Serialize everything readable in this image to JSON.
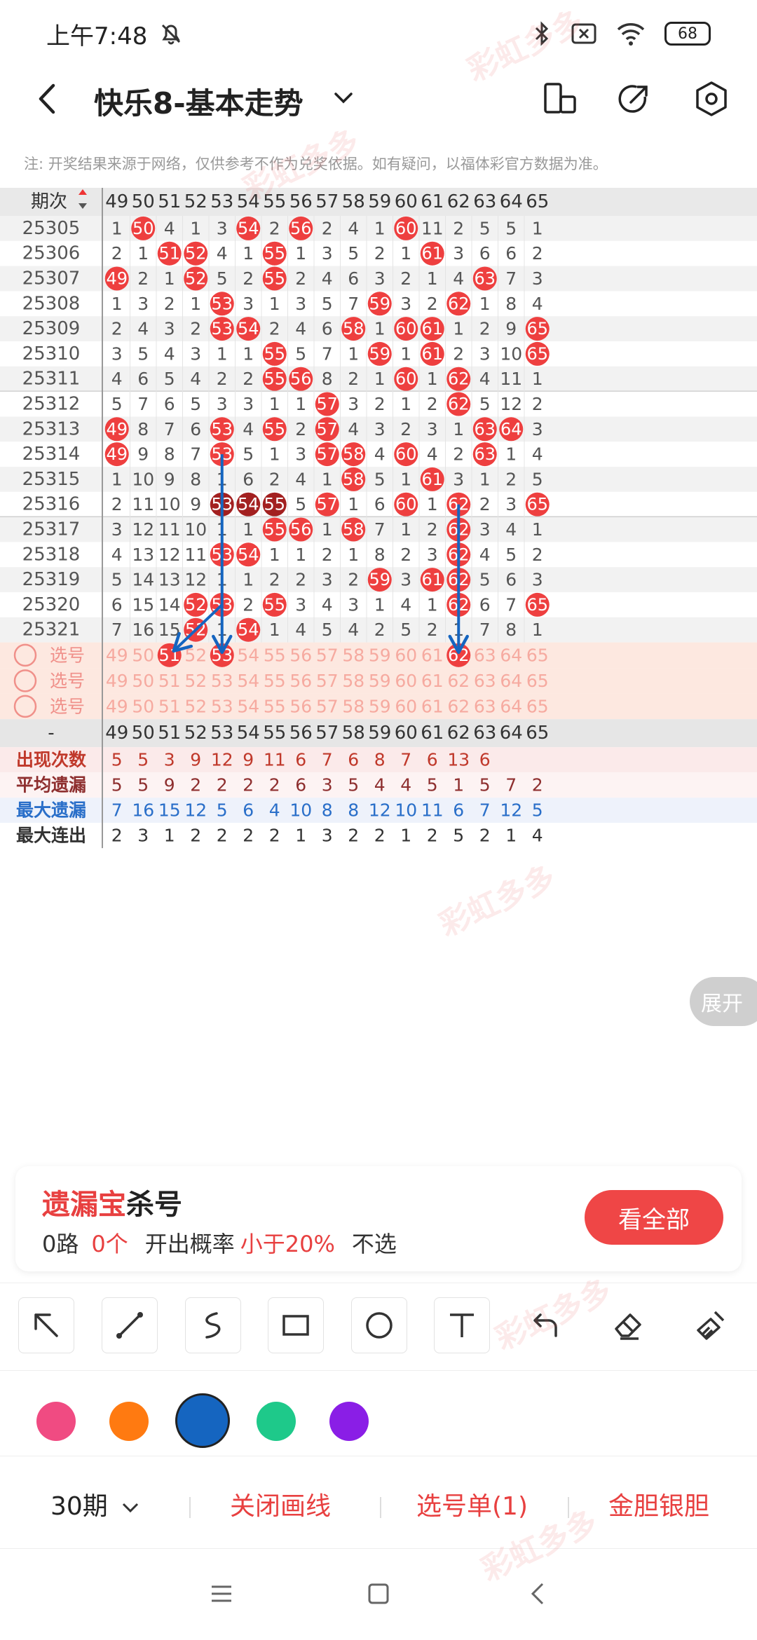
{
  "status_bar": {
    "time": "上午7:48",
    "battery": "68"
  },
  "header": {
    "title": "快乐8-基本走势"
  },
  "note": "注: 开奖结果来源于网络，仅供参考不作为兑奖依据。如有疑问，以福体彩官方数据为准。",
  "table": {
    "period_label": "期次",
    "columns": [
      "49",
      "50",
      "51",
      "52",
      "53",
      "54",
      "55",
      "56",
      "57",
      "58",
      "59",
      "60",
      "61",
      "62",
      "63",
      "64",
      "65"
    ],
    "rows": [
      {
        "period": "25305",
        "cells": [
          "1",
          "50",
          "4",
          "1",
          "3",
          "54",
          "2",
          "56",
          "2",
          "4",
          "1",
          "60",
          "11",
          "2",
          "5",
          "5",
          "1"
        ]
      },
      {
        "period": "25306",
        "cells": [
          "2",
          "1",
          "51",
          "52",
          "4",
          "1",
          "55",
          "1",
          "3",
          "5",
          "2",
          "1",
          "61",
          "3",
          "6",
          "6",
          "2"
        ]
      },
      {
        "period": "25307",
        "cells": [
          "49",
          "2",
          "1",
          "52",
          "5",
          "2",
          "55",
          "2",
          "4",
          "6",
          "3",
          "2",
          "1",
          "4",
          "63",
          "7",
          "3"
        ]
      },
      {
        "period": "25308",
        "cells": [
          "1",
          "3",
          "2",
          "1",
          "53",
          "3",
          "1",
          "3",
          "5",
          "7",
          "59",
          "3",
          "2",
          "62",
          "1",
          "8",
          "4"
        ]
      },
      {
        "period": "25309",
        "cells": [
          "2",
          "4",
          "3",
          "2",
          "53",
          "54",
          "2",
          "4",
          "6",
          "58",
          "1",
          "60",
          "61",
          "1",
          "2",
          "9",
          "65"
        ]
      },
      {
        "period": "25310",
        "cells": [
          "3",
          "5",
          "4",
          "3",
          "1",
          "1",
          "55",
          "5",
          "7",
          "1",
          "59",
          "1",
          "61",
          "2",
          "3",
          "10",
          "65"
        ]
      },
      {
        "period": "25311",
        "cells": [
          "4",
          "6",
          "5",
          "4",
          "2",
          "2",
          "55",
          "56",
          "8",
          "2",
          "1",
          "60",
          "1",
          "62",
          "4",
          "11",
          "1"
        ]
      },
      {
        "period": "25312",
        "cells": [
          "5",
          "7",
          "6",
          "5",
          "3",
          "3",
          "1",
          "1",
          "57",
          "3",
          "2",
          "1",
          "2",
          "62",
          "5",
          "12",
          "2"
        ]
      },
      {
        "period": "25313",
        "cells": [
          "49",
          "8",
          "7",
          "6",
          "53",
          "4",
          "55",
          "2",
          "57",
          "4",
          "3",
          "2",
          "3",
          "1",
          "63",
          "64",
          "3"
        ]
      },
      {
        "period": "25314",
        "cells": [
          "49",
          "9",
          "8",
          "7",
          "53",
          "5",
          "1",
          "3",
          "57",
          "58",
          "4",
          "60",
          "4",
          "2",
          "63",
          "1",
          "4"
        ]
      },
      {
        "period": "25315",
        "cells": [
          "1",
          "10",
          "9",
          "8",
          "1",
          "6",
          "2",
          "4",
          "1",
          "58",
          "5",
          "1",
          "61",
          "3",
          "1",
          "2",
          "5"
        ]
      },
      {
        "period": "25316",
        "cells": [
          "2",
          "11",
          "10",
          "9",
          "53",
          "54",
          "55",
          "5",
          "57",
          "1",
          "6",
          "60",
          "1",
          "62",
          "2",
          "3",
          "65"
        ]
      },
      {
        "period": "25317",
        "cells": [
          "3",
          "12",
          "11",
          "10",
          "1",
          "1",
          "55",
          "56",
          "1",
          "58",
          "7",
          "1",
          "2",
          "62",
          "3",
          "4",
          "1"
        ]
      },
      {
        "period": "25318",
        "cells": [
          "4",
          "13",
          "12",
          "11",
          "53",
          "54",
          "1",
          "1",
          "2",
          "1",
          "8",
          "2",
          "3",
          "62",
          "4",
          "5",
          "2"
        ]
      },
      {
        "period": "25319",
        "cells": [
          "5",
          "14",
          "13",
          "12",
          "1",
          "1",
          "2",
          "2",
          "3",
          "2",
          "59",
          "3",
          "61",
          "62",
          "5",
          "6",
          "3"
        ]
      },
      {
        "period": "25320",
        "cells": [
          "6",
          "15",
          "14",
          "52",
          "53",
          "2",
          "55",
          "3",
          "4",
          "3",
          "1",
          "4",
          "1",
          "62",
          "6",
          "7",
          "65"
        ]
      },
      {
        "period": "25321",
        "cells": [
          "7",
          "16",
          "15",
          "52",
          "1",
          "54",
          "1",
          "4",
          "5",
          "4",
          "2",
          "5",
          "2",
          "1",
          "7",
          "8",
          "1"
        ]
      }
    ],
    "pick_label": "选号",
    "footer_dash": "-",
    "stats": [
      {
        "label": "出现次数",
        "values": [
          "5",
          "5",
          "3",
          "9",
          "12",
          "9",
          "11",
          "6",
          "7",
          "6",
          "8",
          "7",
          "6",
          "13",
          "6",
          "",
          ""
        ]
      },
      {
        "label": "平均遗漏",
        "values": [
          "5",
          "5",
          "9",
          "2",
          "2",
          "2",
          "2",
          "6",
          "3",
          "5",
          "4",
          "4",
          "5",
          "1",
          "5",
          "7",
          "2"
        ]
      },
      {
        "label": "最大遗漏",
        "values": [
          "7",
          "16",
          "15",
          "12",
          "5",
          "6",
          "4",
          "10",
          "8",
          "8",
          "12",
          "10",
          "11",
          "6",
          "7",
          "12",
          "5"
        ]
      },
      {
        "label": "最大连出",
        "values": [
          "2",
          "3",
          "1",
          "2",
          "2",
          "2",
          "2",
          "1",
          "3",
          "2",
          "2",
          "1",
          "2",
          "5",
          "2",
          "1",
          "4"
        ]
      }
    ]
  },
  "expand_label": "展开",
  "kill_card": {
    "title_red": "遗漏宝",
    "title_rest": "杀号",
    "road": "0路",
    "count": "0个",
    "prob_label": "开出概率",
    "prob_value": "小于20%",
    "action": "不选",
    "button": "看全部"
  },
  "colors": {
    "swatches": [
      "#f04b82",
      "#ff7a11",
      "#1565c0",
      "#1ec98a",
      "#8a1ee6"
    ],
    "selected": "#1565c0",
    "red": "#ee3f3f",
    "dark_red": "#a32020"
  },
  "bottom_bar": {
    "period": "30期",
    "close_draw": "关闭画线",
    "pick_list": "选号单(1)",
    "gold": "金胆银胆"
  },
  "watermark": "彩虹多多"
}
